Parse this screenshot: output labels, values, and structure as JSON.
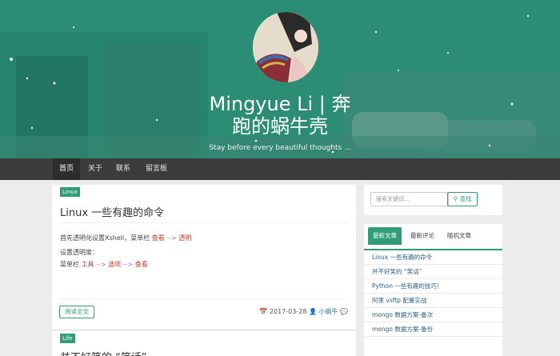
{
  "header": {
    "title": "Mingyue Li | 奔跑的蜗牛壳",
    "title_line1": "Mingyue Li | 奔",
    "title_line2": "跑的蜗牛壳",
    "subtitle": "Stay before every beautiful thoughts ..."
  },
  "nav": {
    "items": [
      "首页",
      "关于",
      "联系",
      "留言板"
    ]
  },
  "post": {
    "tag": "Linux",
    "title": "Linux 一些有趣的命令",
    "line1_prefix": "首先透明化设置Xshell，菜单栏",
    "line1_a": "查看",
    "arrow": "-->",
    "line1_b": "透明",
    "line2": "设置透明度：",
    "line3_prefix": "菜单栏",
    "line3_a": "工具",
    "line3_b": "选项",
    "line3_c": "查看",
    "read_more": "阅读全文",
    "date": "2017-03-28",
    "author": "小蜗牛"
  },
  "post2": {
    "tag": "Life",
    "title": "并不好笑的 “笑话”"
  },
  "search": {
    "placeholder": "搜索关键词...",
    "button": "查找"
  },
  "sidebar_tabs": {
    "tabs": [
      "最新文章",
      "最新评论",
      "随机文章"
    ],
    "recent": [
      "Linux 一些有趣的命令",
      "并不好笑的 “笑话”",
      "Python 一些有趣的技巧！",
      "阿里 vsftp 配置实战",
      "mongo 数据方案-备次",
      "mongo 数据方案-备份"
    ]
  },
  "colors": {
    "accent": "#2f9d78",
    "nav_bg": "#3c3c3c",
    "link": "#2c5f80",
    "highlight": "#c0392b"
  }
}
